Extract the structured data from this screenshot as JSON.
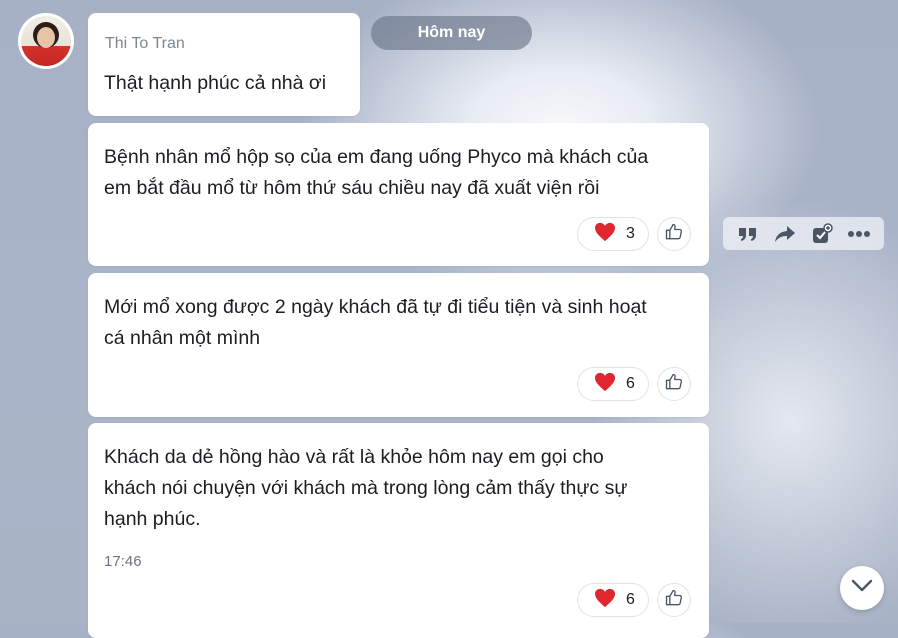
{
  "date_separator": "Hôm nay",
  "messages": [
    {
      "sender": "Thi To Tran",
      "text": "Thật hạnh phúc cả nhà ơi"
    },
    {
      "lines": [
        "Bệnh nhân mổ hộp sọ của em đang uống Phyco mà khách của",
        "em bắt đầu mổ từ hôm thứ sáu chiều nay đã xuất viện rồi"
      ],
      "reaction": {
        "icon": "heart-icon",
        "count": "3"
      }
    },
    {
      "lines": [
        "Mới mổ xong được 2 ngày khách đã tự đi tiểu tiện và sinh hoạt",
        "cá nhân một mình"
      ],
      "reaction": {
        "icon": "heart-icon",
        "count": "6"
      }
    },
    {
      "lines": [
        "Khách da dẻ hồng hào và rất là khỏe hôm nay em gọi cho",
        "khách nói chuyện với khách mà trong lòng cảm thấy thực sự",
        "hạnh phúc."
      ],
      "time": "17:46",
      "reaction": {
        "icon": "heart-icon",
        "count": "6"
      }
    }
  ],
  "toolbar_icons": [
    "quote-icon",
    "share-icon",
    "add-task-icon",
    "more-icon"
  ],
  "colors": {
    "heart": "#e0262f",
    "icon": "#4a5566"
  }
}
